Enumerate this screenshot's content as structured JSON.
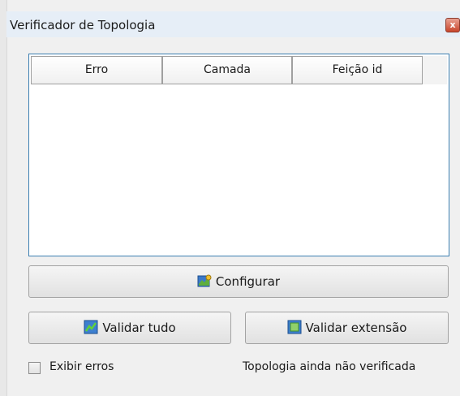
{
  "window": {
    "title": "Verificador de Topologia",
    "close_glyph": "x"
  },
  "table": {
    "columns": [
      "Erro",
      "Camada",
      "Feição id"
    ],
    "rows": []
  },
  "buttons": {
    "configure": {
      "label": "Configurar",
      "icon": "configure-icon"
    },
    "validate_all": {
      "label": "Validar tudo",
      "icon": "validate-all-icon"
    },
    "validate_extent": {
      "label": "Validar extensão",
      "icon": "validate-extent-icon"
    }
  },
  "show_errors": {
    "label": "Exibir erros",
    "checked": false
  },
  "status": {
    "text": "Topologia ainda não verificada"
  }
}
